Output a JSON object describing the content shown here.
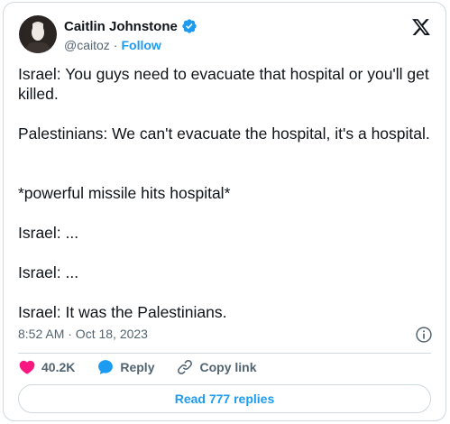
{
  "author": {
    "name": "Caitlin Johnstone",
    "handle": "@caitoz",
    "separator": "·",
    "follow_label": "Follow"
  },
  "tweet": {
    "lines": [
      "Israel: You guys need to evacuate that hospital or you'll get killed.",
      "Palestinians: We can't evacuate the hospital, it's a hospital.",
      "*powerful missile hits hospital*",
      "Israel: ...",
      "Israel: ...",
      "Israel: It was the Palestinians."
    ],
    "timestamp": "8:52 AM · Oct 18, 2023"
  },
  "actions": {
    "likes": "40.2K",
    "reply_label": "Reply",
    "copy_link_label": "Copy link"
  },
  "replies_button": "Read 777 replies",
  "colors": {
    "accent": "#1d9bf0",
    "like": "#f91880",
    "secondary_text": "#536471",
    "border": "#cfd9de"
  },
  "icons": [
    "verified-badge-icon",
    "x-logo-icon",
    "info-icon",
    "heart-icon",
    "reply-bubble-icon",
    "link-icon"
  ]
}
